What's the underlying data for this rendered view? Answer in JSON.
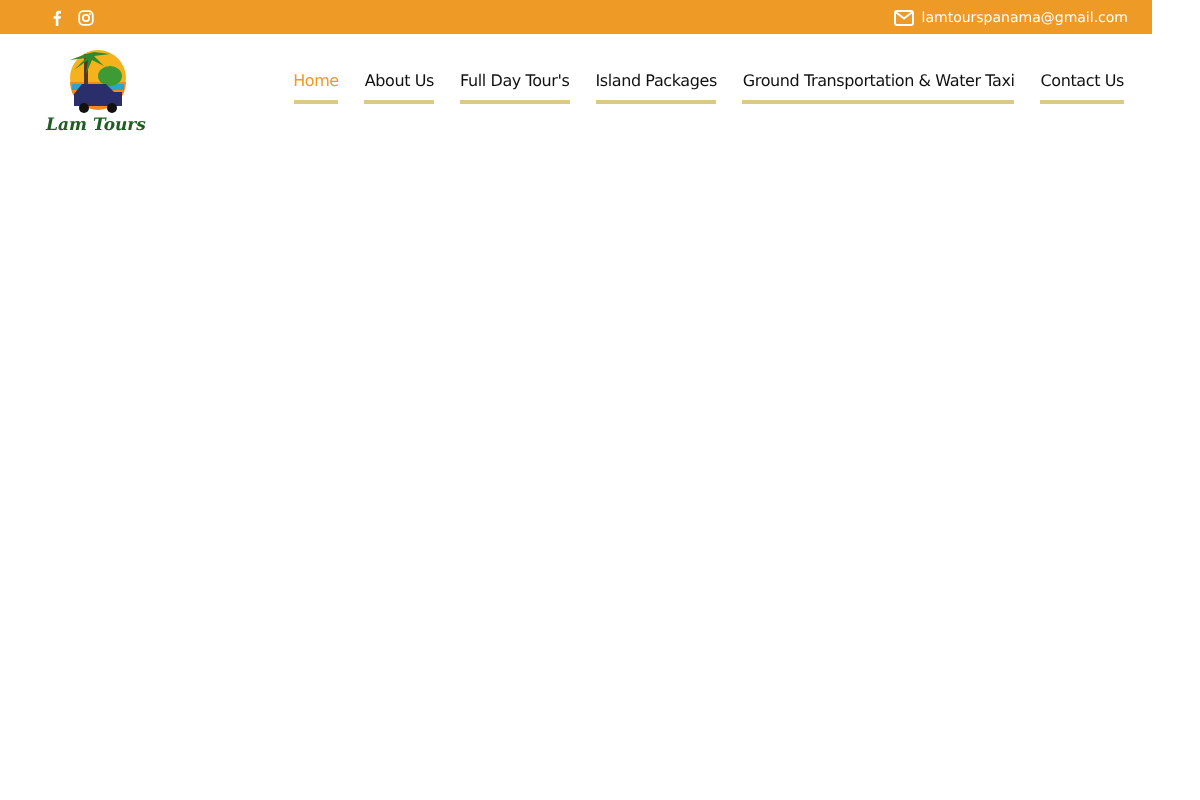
{
  "topbar": {
    "email": "lamtourspanama@gmail.com"
  },
  "logo": {
    "text": "Lam Tours"
  },
  "nav": [
    {
      "label": "Home",
      "selected": true
    },
    {
      "label": "About Us",
      "selected": false
    },
    {
      "label": "Full Day Tour's",
      "selected": false
    },
    {
      "label": "Island Packages",
      "selected": false
    },
    {
      "label": "Ground Transportation & Water Taxi",
      "selected": false
    },
    {
      "label": "Contact Us",
      "selected": false
    }
  ]
}
